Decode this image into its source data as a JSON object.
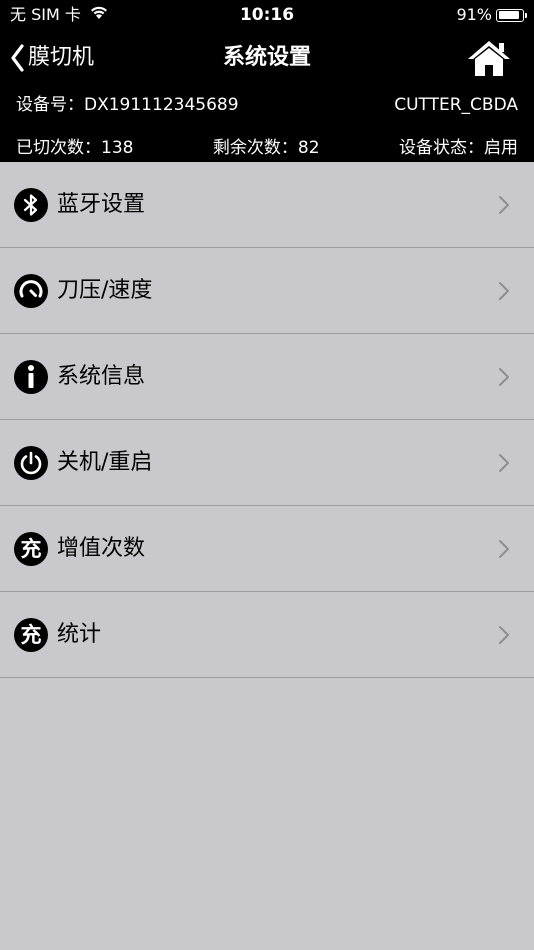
{
  "status_bar": {
    "carrier": "无 SIM 卡",
    "time": "10:16",
    "battery_text": "91%",
    "battery_level": 0.91
  },
  "nav": {
    "back_label": "膜切机",
    "title": "系统设置"
  },
  "device": {
    "id_label": "设备号：DX191112345689",
    "model": "CUTTER_CBDA",
    "cut_count": "已切次数：138",
    "remaining_count": "剩余次数：82",
    "status": "设备状态：启用"
  },
  "menu": {
    "items": [
      {
        "label": "蓝牙设置",
        "icon": "bluetooth-icon"
      },
      {
        "label": "刀压/速度",
        "icon": "gauge-icon"
      },
      {
        "label": "系统信息",
        "icon": "info-icon"
      },
      {
        "label": "关机/重启",
        "icon": "power-icon"
      },
      {
        "label": "增值次数",
        "icon": "charge-icon",
        "glyph": "充"
      },
      {
        "label": "统计",
        "icon": "charge-icon",
        "glyph": "充"
      }
    ]
  },
  "colors": {
    "header_bg": "#000000",
    "page_bg": "#c9c8cd",
    "separator": "#9e9da2",
    "chevron": "#8e8d92"
  }
}
